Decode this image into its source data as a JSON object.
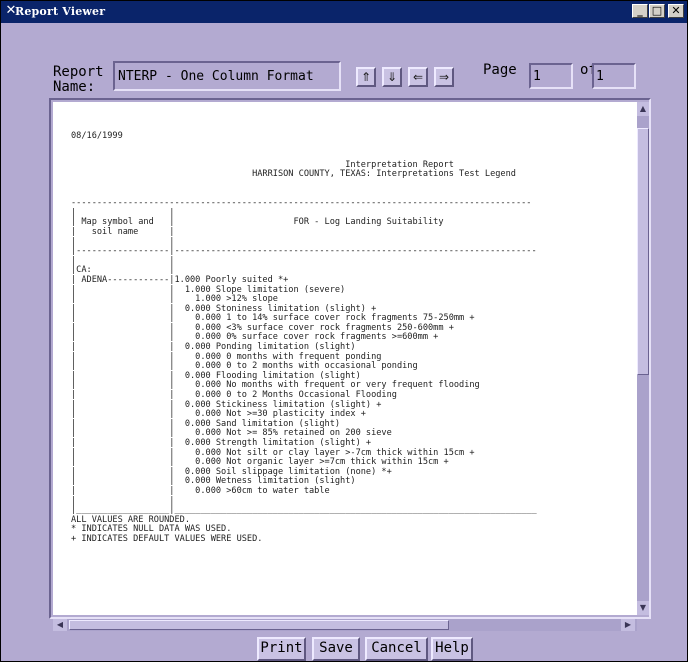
{
  "window": {
    "title": "Report Viewer",
    "icon": "x-window-icon",
    "controls": [
      "minimize-icon",
      "maximize-icon",
      "close-icon"
    ]
  },
  "toolbar": {
    "report_label": "Report\nName:",
    "report_name": "NTERP - One Column Format",
    "nav_icons": [
      "first-page-icon",
      "previous-page-icon",
      "next-page-icon",
      "last-page-icon"
    ],
    "page_label": "Page",
    "page_value": "1",
    "of_label": "of",
    "total_pages": "1"
  },
  "report": {
    "lines": [
      "08/16/1999",
      "",
      "",
      "                                                     Interpretation Report",
      "                                   HARRISON COUNTY, TEXAS: Interpretations Test Legend",
      "",
      "",
      "-----------------------------------------------------------------------------------------",
      "|                  |",
      "| Map symbol and   |                       FOR - Log Landing Suitability",
      "|   soil name      |",
      "|                  |",
      "|------------------|----------------------------------------------------------------------",
      "|                  |",
      "|CA:               |",
      "| ADENA------------|1.000 Poorly suited *+",
      "|                  |  1.000 Slope limitation (severe)",
      "|                  |    1.000 >12% slope",
      "|                  |  0.000 Stoniness limitation (slight) +",
      "|                  |    0.000 1 to 14% surface cover rock fragments 75-250mm +",
      "|                  |    0.000 <3% surface cover rock fragments 250-600mm +",
      "|                  |    0.000 0% surface cover rock fragments >=600mm +",
      "|                  |  0.000 Ponding limitation (slight)",
      "|                  |    0.000 0 months with frequent ponding",
      "|                  |    0.000 0 to 2 months with occasional ponding",
      "|                  |  0.000 Flooding limitation (slight)",
      "|                  |    0.000 No months with frequent or very frequent flooding",
      "|                  |    0.000 0 to 2 Months Occasional Flooding",
      "|                  |  0.000 Stickiness limitation (slight) +",
      "|                  |    0.000 Not >=30 plasticity index +",
      "|                  |  0.000 Sand limitation (slight)",
      "|                  |    0.000 Not >= 85% retained on 200 sieve",
      "|                  |  0.000 Strength limitation (slight) +",
      "|                  |    0.000 Not silt or clay layer >-7cm thick within 15cm +",
      "|                  |    0.000 Not organic layer >=7cm thick within 15cm +",
      "|                  |  0.000 Soil slippage limitation (none) *+",
      "|                  |  0.000 Wetness limitation (slight)",
      "|                  |    0.000 >60cm to water table",
      "|                  |",
      "|__________________|______________________________________________________________________",
      "ALL VALUES ARE ROUNDED.",
      "* INDICATES NULL DATA WAS USED.",
      "+ INDICATES DEFAULT VALUES WERE USED."
    ]
  },
  "buttons": {
    "print": "Print",
    "save": "Save",
    "cancel": "Cancel",
    "help": "Help"
  }
}
